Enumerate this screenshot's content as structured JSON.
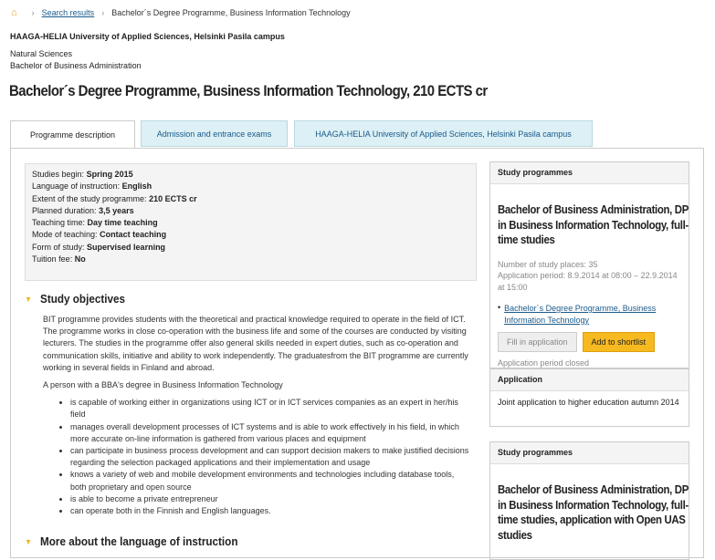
{
  "breadcrumb": {
    "home_icon": "home-icon",
    "search_results": "Search results",
    "current": "Bachelor´s Degree Programme, Business Information Technology"
  },
  "org": "HAAGA-HELIA University of Applied Sciences, Helsinki Pasila campus",
  "field": "Natural Sciences",
  "degree": "Bachelor of Business Administration",
  "title": "Bachelor´s Degree Programme, Business Information Technology, 210 ECTS cr",
  "tabs": [
    {
      "label": "Programme description"
    },
    {
      "label": "Admission and entrance exams"
    },
    {
      "label": "HAAGA-HELIA University of Applied Sciences, Helsinki Pasila campus"
    }
  ],
  "facts": [
    {
      "label": "Studies begin:",
      "value": "Spring 2015"
    },
    {
      "label": "Language of instruction:",
      "value": "English"
    },
    {
      "label": "Extent of the study programme:",
      "value": "210 ECTS cr"
    },
    {
      "label": "Planned duration:",
      "value": "3,5 years"
    },
    {
      "label": "Teaching time:",
      "value": "Day time teaching"
    },
    {
      "label": "Mode of teaching:",
      "value": "Contact teaching"
    },
    {
      "label": "Form of study:",
      "value": "Supervised learning"
    },
    {
      "label": "Tuition fee:",
      "value": "No"
    }
  ],
  "study_objectives": {
    "heading": "Study objectives",
    "paragraph1": "BIT programme provides students with the theoretical and practical knowledge required to operate in the field of ICT. The programme works in close co-operation with the business life and some of the courses are conducted by visiting lecturers. The studies in the programme offer also general skills needed in expert duties, such as co-operation and communication skills, initiative and ability to work independently. The graduatesfrom the BIT programme are currently working in several fields in Finland and abroad.",
    "paragraph2": "A person with a BBA's degree in Business Information Technology",
    "bullets": [
      "is capable of working either in organizations using ICT or in ICT services companies as an expert in her/his field",
      "manages overall development processes of ICT systems and is able to work effectively in his field, in which more accurate on-line information is gathered from various places and equipment",
      "can participate in business process development and can support decision makers to make justified decisions regarding the selection packaged applications and their implementation and usage",
      "knows a variety of web and mobile development environments and technologies including database tools, both proprietary and open source",
      "is able to become a private entrepreneur",
      "can operate both in the Finnish and English languages."
    ]
  },
  "more_language": {
    "heading": "More about the language of instruction"
  },
  "sidebar": {
    "box1": {
      "heading": "Study programmes",
      "title": "Bachelor of Business Administration, DP in Business Information Technology, full-time studies",
      "places": "Number of study places: 35",
      "period": "Application period: 8.9.2014 at 08:00 – 22.9.2014 at 15:00",
      "link": "Bachelor´s Degree Programme, Business Information Technology",
      "fill_button": "Fill in application",
      "shortlist_button": "Add to shortlist",
      "closed": "Application period closed"
    },
    "application": {
      "heading": "Application",
      "text": "Joint application to higher education autumn 2014"
    },
    "box2": {
      "heading": "Study programmes",
      "title": "Bachelor of Business Administration, DP in Business Information Technology, full-time studies, application with Open UAS studies"
    }
  }
}
